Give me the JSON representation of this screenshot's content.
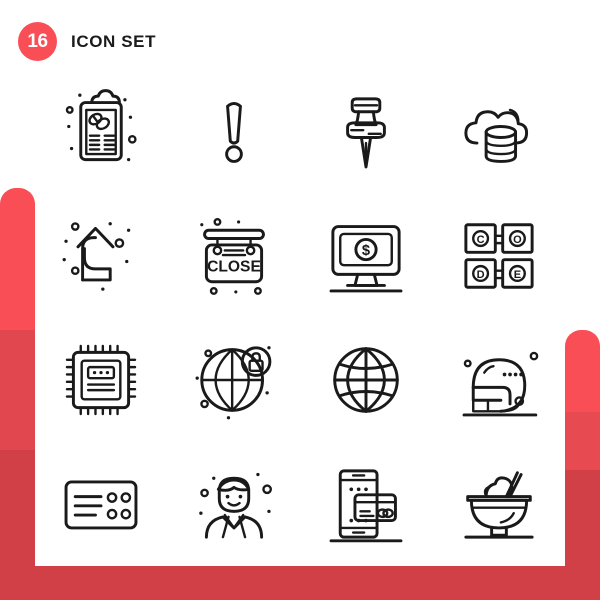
{
  "header": {
    "count": "16",
    "title": "ICON SET"
  },
  "colors": {
    "accent_bright": "#fa4e56",
    "accent_mid": "#e0474e",
    "accent_dark": "#d24047",
    "ink": "#1a1a1a",
    "background": "#ffffff"
  },
  "icons": [
    {
      "name": "prescription-clipboard-icon",
      "label": "Prescription Clipboard"
    },
    {
      "name": "exclamation-mark-icon",
      "label": "Exclamation Mark"
    },
    {
      "name": "push-pin-icon",
      "label": "Push Pin"
    },
    {
      "name": "cloud-database-icon",
      "label": "Cloud Database"
    },
    {
      "name": "curved-up-arrow-icon",
      "label": "Curved Up Arrow"
    },
    {
      "name": "close-sign-icon",
      "label": "Close Sign"
    },
    {
      "name": "monitor-dollar-icon",
      "label": "Monitor Dollar"
    },
    {
      "name": "code-blocks-icon",
      "label": "Code Blocks"
    },
    {
      "name": "microchip-icon",
      "label": "Microchip"
    },
    {
      "name": "secure-globe-icon",
      "label": "Secure Globe"
    },
    {
      "name": "wireframe-globe-icon",
      "label": "Wireframe Globe"
    },
    {
      "name": "football-helmet-icon",
      "label": "Football Helmet"
    },
    {
      "name": "id-card-icon",
      "label": "ID Card"
    },
    {
      "name": "businessman-avatar-icon",
      "label": "Businessman Avatar"
    },
    {
      "name": "mobile-payment-icon",
      "label": "Mobile Payment"
    },
    {
      "name": "dessert-bowl-icon",
      "label": "Dessert Bowl"
    }
  ],
  "glyph_labels": {
    "close_sign": "CLOSE",
    "code_blocks": [
      "C",
      "O",
      "D",
      "E"
    ],
    "currency": "$"
  }
}
